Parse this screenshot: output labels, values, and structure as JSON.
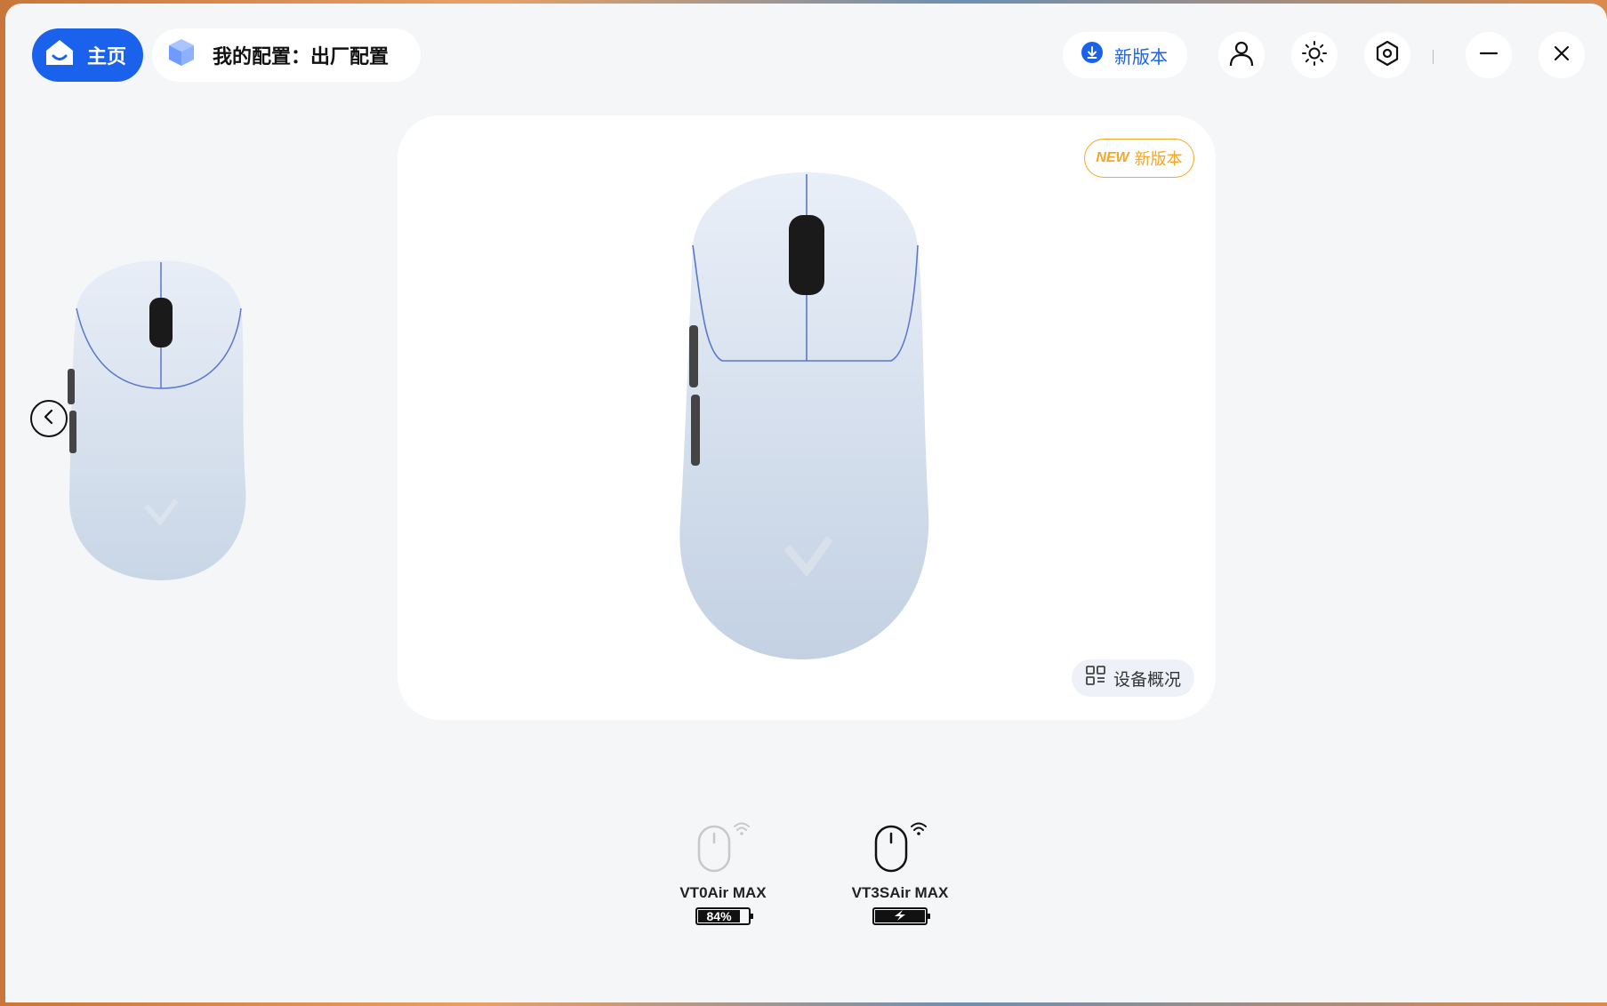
{
  "header": {
    "home_label": "主页",
    "config_label": "我的配置：出厂配置",
    "update_label": "新版本"
  },
  "card": {
    "new_tag": "NEW",
    "new_label": "新版本",
    "overview_label": "设备概况"
  },
  "devices": [
    {
      "name": "VT0Air MAX",
      "battery_text": "84%",
      "battery_level": 84,
      "active": false
    },
    {
      "name": "VT3SAir MAX",
      "battery_text": "",
      "battery_level": 100,
      "charging": true,
      "active": true
    }
  ],
  "colors": {
    "accent": "#1a62ec",
    "badge": "#f5a623",
    "background": "#f4f6f8"
  }
}
